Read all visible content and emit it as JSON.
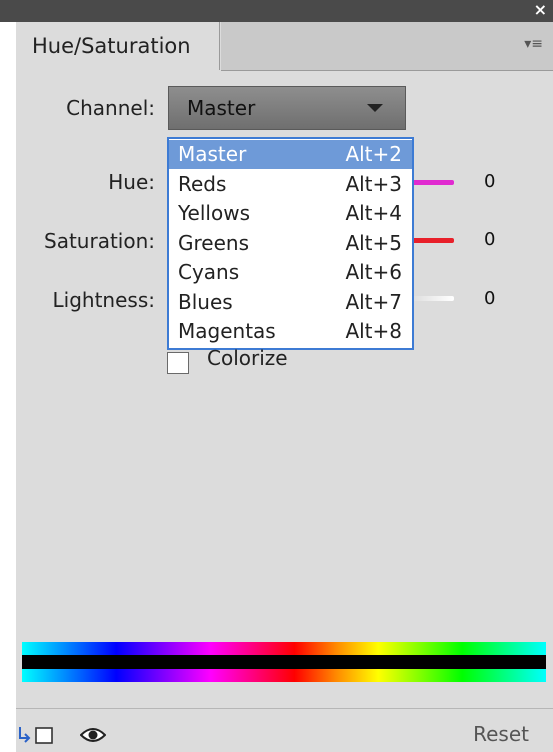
{
  "window": {
    "close_glyph": "×"
  },
  "panel": {
    "tab_label": "Hue/Saturation",
    "menu_icon": "panel-menu-icon"
  },
  "channel": {
    "label": "Channel:",
    "selected": "Master",
    "options": [
      {
        "name": "Master",
        "shortcut": "Alt+2"
      },
      {
        "name": "Reds",
        "shortcut": "Alt+3"
      },
      {
        "name": "Yellows",
        "shortcut": "Alt+4"
      },
      {
        "name": "Greens",
        "shortcut": "Alt+5"
      },
      {
        "name": "Cyans",
        "shortcut": "Alt+6"
      },
      {
        "name": "Blues",
        "shortcut": "Alt+7"
      },
      {
        "name": "Magentas",
        "shortcut": "Alt+8"
      }
    ]
  },
  "adjustments": {
    "hue": {
      "label": "Hue:",
      "value": "0",
      "color": "#e02ad0"
    },
    "saturation": {
      "label": "Saturation:",
      "value": "0",
      "color": "#e8202a"
    },
    "lightness": {
      "label": "Lightness:",
      "value": "0",
      "color": "#f4f4f4"
    }
  },
  "colorize": {
    "label": "Colorize",
    "checked": false
  },
  "footer": {
    "reset_label": "Reset"
  },
  "colors": {
    "panel_bg": "#dcdcdc",
    "menu_highlight": "#6e9ad8",
    "menu_border": "#3d7bd4"
  }
}
